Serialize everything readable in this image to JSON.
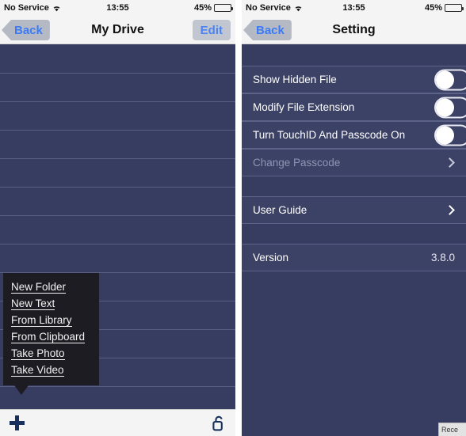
{
  "status_bar": {
    "carrier": "No Service",
    "wifi_icon": "wifi-icon",
    "time": "13:55",
    "battery_percent": "45%",
    "battery_icon": "battery-icon"
  },
  "colors": {
    "panel_background": "#373d61",
    "row_background": "#3c4266",
    "separator": "#5c6288",
    "nav_background": "#f4f4f4",
    "tint_blue": "#3b7bf6",
    "popup_background": "#1c1c22",
    "disabled_text": "#8f95b3"
  },
  "left_panel": {
    "nav": {
      "back_label": "Back",
      "title": "My Drive",
      "edit_label": "Edit"
    },
    "file_rows": [
      "",
      "",
      "",
      "",
      "",
      "",
      "",
      "",
      "",
      "",
      "",
      ""
    ],
    "popup_menu": {
      "items": [
        {
          "label": "New Folder"
        },
        {
          "label": "New Text"
        },
        {
          "label": "From Library"
        },
        {
          "label": "From Clipboard"
        },
        {
          "label": "Take Photo"
        },
        {
          "label": "Take Video"
        }
      ]
    },
    "toolbar": {
      "add_icon": "plus-icon",
      "lock_icon": "unlock-icon"
    }
  },
  "right_panel": {
    "nav": {
      "back_label": "Back",
      "title": "Setting"
    },
    "sections": [
      {
        "rows": [
          {
            "label": "Show Hidden File",
            "type": "toggle",
            "value": "off",
            "name": "show-hidden-file"
          },
          {
            "label": "Modify File Extension",
            "type": "toggle",
            "value": "off",
            "name": "modify-file-extension"
          },
          {
            "label": "Turn TouchID And Passcode On",
            "type": "toggle",
            "value": "off",
            "name": "turn-touchid-and-passcode-on"
          },
          {
            "label": "Change Passcode",
            "type": "disclosure",
            "value": "",
            "disabled": true,
            "name": "change-passcode"
          }
        ]
      },
      {
        "rows": [
          {
            "label": "User Guide",
            "type": "disclosure",
            "value": "",
            "disabled": false,
            "name": "user-guide"
          }
        ]
      },
      {
        "rows": [
          {
            "label": "Version",
            "type": "value",
            "value": "3.8.0",
            "disabled": false,
            "name": "version"
          }
        ]
      }
    ]
  },
  "stray_widget": {
    "label": "Rece"
  }
}
